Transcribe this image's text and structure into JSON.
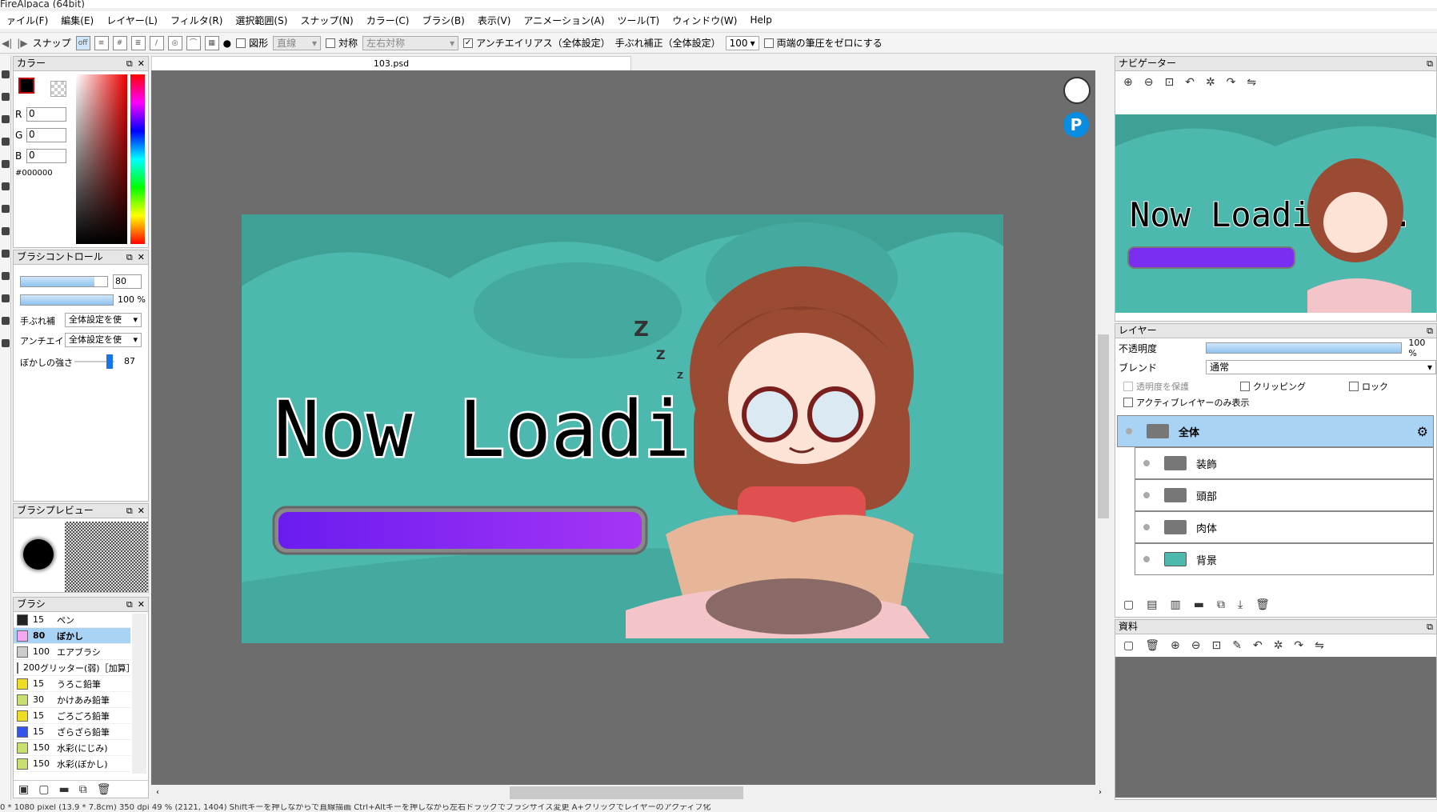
{
  "window": {
    "title": "FireAlpaca (64bit)"
  },
  "menu": [
    "ァイル(F)",
    "編集(E)",
    "レイヤー(L)",
    "フィルタ(R)",
    "選択範囲(S)",
    "スナップ(N)",
    "カラー(C)",
    "ブラシ(B)",
    "表示(V)",
    "アニメーション(A)",
    "ツール(T)",
    "ウィンドウ(W)",
    "Help"
  ],
  "toolbar": {
    "snap_label": "スナップ",
    "snap_off": "off",
    "shape_label": "図形",
    "shape_value": "直線",
    "symmetry_label": "対称",
    "symmetry_value": "左右対称",
    "antialias_label": "アンチエイリアス（全体設定）",
    "stabilizer_label": "手ぶれ補正（全体設定）",
    "stabilizer_value": "100",
    "pressure_label": "両端の筆圧をゼロにする"
  },
  "color_panel": {
    "title": "カラー",
    "r_label": "R",
    "r": "0",
    "g_label": "G",
    "g": "0",
    "b_label": "B",
    "b": "0",
    "hex": "#000000"
  },
  "brush_control": {
    "title": "ブラシコントロール",
    "size": "80",
    "opacity": "100 %",
    "stabilizer_label": "手ぶれ補",
    "stabilizer_value": "全体設定を使",
    "antialias_label": "アンチエイ!",
    "antialias_value": "全体設定を使",
    "blur_label": "ぼかしの強さ",
    "blur_value": "87",
    "size_fill": 0.85,
    "blur_fill": 0.87
  },
  "brush_preview": {
    "title": "ブラシプレビュー"
  },
  "brush_panel": {
    "title": "ブラシ",
    "items": [
      {
        "size": "15",
        "name": "ペン",
        "color": "#222222"
      },
      {
        "size": "80",
        "name": "ぼかし",
        "color": "#f4a8f4",
        "active": true
      },
      {
        "size": "100",
        "name": "エアブラシ",
        "color": "#cccccc"
      },
      {
        "size": "200",
        "name": "グリッター(弱)［加算］",
        "color": "#3355ee"
      },
      {
        "size": "15",
        "name": "うろこ鉛筆",
        "color": "#eedd22"
      },
      {
        "size": "30",
        "name": "かけあみ鉛筆",
        "color": "#c8e070"
      },
      {
        "size": "15",
        "name": "ごろごろ鉛筆",
        "color": "#eedd22"
      },
      {
        "size": "15",
        "name": "ざらざら鉛筆",
        "color": "#3355ee"
      },
      {
        "size": "150",
        "name": "水彩(にじみ)",
        "color": "#c8e070"
      },
      {
        "size": "150",
        "name": "水彩(ぼかし)",
        "color": "#c8e070"
      }
    ]
  },
  "document": {
    "tab": "103.psd",
    "loading_text": "Now Loading...",
    "zzz": "Z"
  },
  "navigator": {
    "title": "ナビゲーター"
  },
  "layers": {
    "title": "レイヤー",
    "opacity_label": "不透明度",
    "opacity_value": "100 %",
    "blend_label": "ブレンド",
    "blend_value": "通常",
    "protect_label": "透明度を保護",
    "clip_label": "クリッピング",
    "lock_label": "ロック",
    "active_only_label": "アクティブレイヤーのみ表示",
    "items": [
      {
        "name": "全体",
        "kind": "folder",
        "selected": true
      },
      {
        "name": "装飾",
        "kind": "folder"
      },
      {
        "name": "頭部",
        "kind": "folder"
      },
      {
        "name": "肉体",
        "kind": "folder"
      },
      {
        "name": "背景",
        "kind": "image"
      }
    ]
  },
  "material": {
    "title": "資料"
  },
  "status": {
    "text": "0 * 1080 pixel  (13.9 * 7.8cm)  350 dpi  49 %  (2121, 1404)  Shiftキーを押しながらで直線描画  Ctrl+Altキーを押しながら左右ドラッグでブラシサイズ変更  A+クリックでレイヤーのアクティブ化"
  },
  "colors": {
    "accent": "#a9d3f5",
    "canvas_bg": "#6d6d6d",
    "art_teal": "#4db8ad"
  }
}
